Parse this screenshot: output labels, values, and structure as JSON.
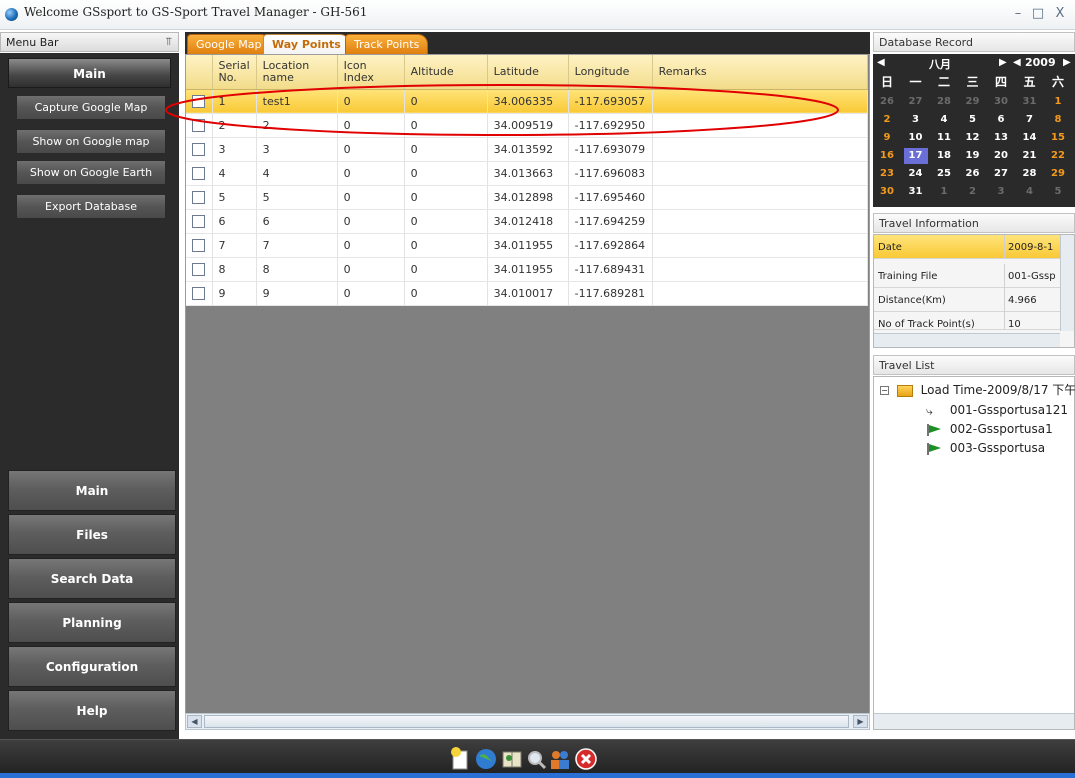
{
  "window": {
    "title": "Welcome GSsport to GS-Sport Travel Manager - GH-561",
    "minimize": "–",
    "maximize": "□",
    "close": "X"
  },
  "left_panel": {
    "header": "Menu Bar",
    "pin": "⫪",
    "main_header": "Main",
    "actions": [
      "Capture Google Map",
      "Show on Google map",
      "Show on Google Earth",
      "Export Database"
    ],
    "nav": [
      "Main",
      "Files",
      "Search Data",
      "Planning",
      "Configuration",
      "Help"
    ]
  },
  "tabs": [
    "Google Map",
    "Way Points",
    "Track Points"
  ],
  "active_tab": "Way Points",
  "grid": {
    "columns": [
      "Serial No.",
      "Location name",
      "Icon Index",
      "Altitude",
      "Latitude",
      "Longitude",
      "Remarks"
    ],
    "rows": [
      {
        "serial": "1",
        "name": "test1",
        "icon": "0",
        "alt": "0",
        "lat": "34.006335",
        "lon": "-117.693057",
        "remarks": ""
      },
      {
        "serial": "2",
        "name": "2",
        "icon": "0",
        "alt": "0",
        "lat": "34.009519",
        "lon": "-117.692950",
        "remarks": ""
      },
      {
        "serial": "3",
        "name": "3",
        "icon": "0",
        "alt": "0",
        "lat": "34.013592",
        "lon": "-117.693079",
        "remarks": ""
      },
      {
        "serial": "4",
        "name": "4",
        "icon": "0",
        "alt": "0",
        "lat": "34.013663",
        "lon": "-117.696083",
        "remarks": ""
      },
      {
        "serial": "5",
        "name": "5",
        "icon": "0",
        "alt": "0",
        "lat": "34.012898",
        "lon": "-117.695460",
        "remarks": ""
      },
      {
        "serial": "6",
        "name": "6",
        "icon": "0",
        "alt": "0",
        "lat": "34.012418",
        "lon": "-117.694259",
        "remarks": ""
      },
      {
        "serial": "7",
        "name": "7",
        "icon": "0",
        "alt": "0",
        "lat": "34.011955",
        "lon": "-117.692864",
        "remarks": ""
      },
      {
        "serial": "8",
        "name": "8",
        "icon": "0",
        "alt": "0",
        "lat": "34.011955",
        "lon": "-117.689431",
        "remarks": ""
      },
      {
        "serial": "9",
        "name": "9",
        "icon": "0",
        "alt": "0",
        "lat": "34.010017",
        "lon": "-117.689281",
        "remarks": ""
      }
    ],
    "selected_row": 0
  },
  "database_record": {
    "header": "Database Record",
    "month": "八月",
    "year": "2009",
    "weekdays": [
      "日",
      "一",
      "二",
      "三",
      "四",
      "五",
      "六"
    ],
    "weeks": [
      [
        "26",
        "27",
        "28",
        "29",
        "30",
        "31",
        "1"
      ],
      [
        "2",
        "3",
        "4",
        "5",
        "6",
        "7",
        "8"
      ],
      [
        "9",
        "10",
        "11",
        "12",
        "13",
        "14",
        "15"
      ],
      [
        "16",
        "17",
        "18",
        "19",
        "20",
        "21",
        "22"
      ],
      [
        "23",
        "24",
        "25",
        "26",
        "27",
        "28",
        "29"
      ],
      [
        "30",
        "31",
        "1",
        "2",
        "3",
        "4",
        "5"
      ]
    ],
    "selected_day": "17"
  },
  "travel_information": {
    "header": "Travel Information",
    "rows": [
      {
        "key": "Date",
        "value": "2009-8-1"
      },
      {
        "key": "Training File",
        "value": "001-Gssp"
      },
      {
        "key": "Distance(Km)",
        "value": "4.966"
      },
      {
        "key": "No of Track Point(s)",
        "value": "10"
      }
    ]
  },
  "travel_list": {
    "header": "Travel List",
    "root": "Load Time-2009/8/17 下午",
    "items": [
      "001-Gssportusa121",
      "002-Gssportusa1",
      "003-Gssportusa"
    ]
  },
  "colors": {
    "accent_orange": "#f39a1c",
    "selection_yellow": "#f9c936",
    "panel_dark": "#2b2b2b",
    "annotation_red": "#e00000"
  }
}
